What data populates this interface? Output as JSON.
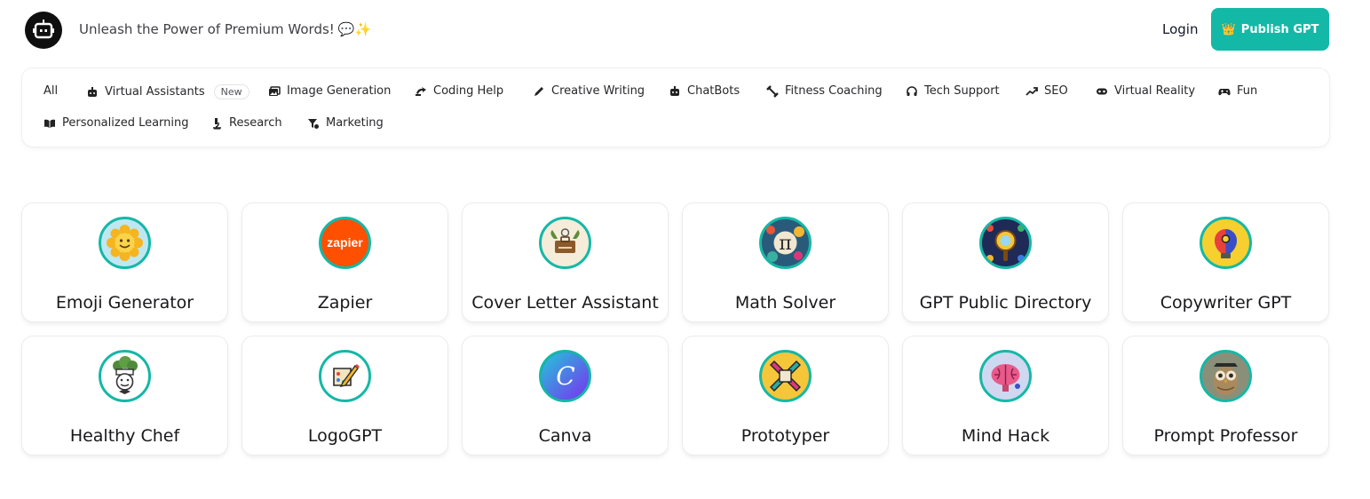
{
  "header": {
    "tagline": "Unleash the Power of Premium Words!",
    "tagline_emoji": "💬✨",
    "login_label": "Login",
    "publish_label": "Publish GPT",
    "publish_emoji": "👑",
    "accent_color": "#14b8a6"
  },
  "categories": [
    {
      "label": "All",
      "icon": ""
    },
    {
      "label": "Virtual Assistants",
      "icon": "robot-icon",
      "badge": "New"
    },
    {
      "label": "Image Generation",
      "icon": "images-icon"
    },
    {
      "label": "Coding Help",
      "icon": "code-icon"
    },
    {
      "label": "Creative Writing",
      "icon": "pencil-icon"
    },
    {
      "label": "ChatBots",
      "icon": "robot-icon"
    },
    {
      "label": "Fitness Coaching",
      "icon": "dumbbell-icon"
    },
    {
      "label": "Tech Support",
      "icon": "headset-icon"
    },
    {
      "label": "SEO",
      "icon": "trending-up-icon"
    },
    {
      "label": "Virtual Reality",
      "icon": "vr-goggles-icon"
    },
    {
      "label": "Fun",
      "icon": "gamepad-icon"
    },
    {
      "label": "Personalized Learning",
      "icon": "book-open-icon"
    },
    {
      "label": "Research",
      "icon": "microscope-icon"
    },
    {
      "label": "Marketing",
      "icon": "megaphone-icon"
    }
  ],
  "gpts": [
    {
      "title": "Emoji Generator",
      "icon": "sunflower-emoji-icon"
    },
    {
      "title": "Zapier",
      "icon": "zapier-logo-icon"
    },
    {
      "title": "Cover Letter Assistant",
      "icon": "briefcase-icon"
    },
    {
      "title": "Math Solver",
      "icon": "pi-icon"
    },
    {
      "title": "GPT Public Directory",
      "icon": "magnifier-icon"
    },
    {
      "title": "Copywriter GPT",
      "icon": "lightbulb-icon"
    },
    {
      "title": "Healthy Chef",
      "icon": "chef-broccoli-icon"
    },
    {
      "title": "LogoGPT",
      "icon": "pencil-palette-icon"
    },
    {
      "title": "Canva",
      "icon": "canva-logo-icon"
    },
    {
      "title": "Prototyper",
      "icon": "tools-icon"
    },
    {
      "title": "Mind Hack",
      "icon": "brain-icon"
    },
    {
      "title": "Prompt Professor",
      "icon": "owl-icon"
    }
  ]
}
